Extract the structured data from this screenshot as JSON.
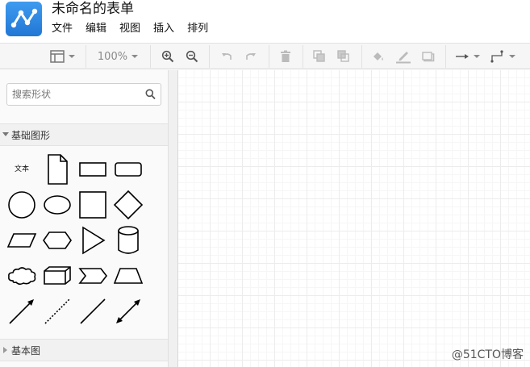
{
  "header": {
    "title": "未命名的表单",
    "menu": [
      "文件",
      "编辑",
      "视图",
      "插入",
      "排列"
    ]
  },
  "toolbar": {
    "zoom": "100%"
  },
  "sidebar": {
    "search_placeholder": "搜索形状",
    "sections": [
      {
        "label": "基础图形",
        "expanded": true
      },
      {
        "label": "基本图",
        "expanded": false
      }
    ],
    "shapes": {
      "text_label": "文本",
      "items": [
        "text",
        "document",
        "rectangle",
        "rounded-rectangle",
        "circle",
        "ellipse",
        "square",
        "diamond",
        "parallelogram",
        "hexagon",
        "triangle",
        "cylinder",
        "cloud",
        "cube",
        "step",
        "trapezoid",
        "arrow",
        "dotted-line",
        "line",
        "bidirectional-arrow"
      ]
    }
  },
  "watermark": "@51CTO博客",
  "colors": {
    "logo": "#2b86e6",
    "toolbar_bg": "#f6f6f6",
    "sidebar_bg": "#fafafa",
    "grid": "#ececec"
  }
}
